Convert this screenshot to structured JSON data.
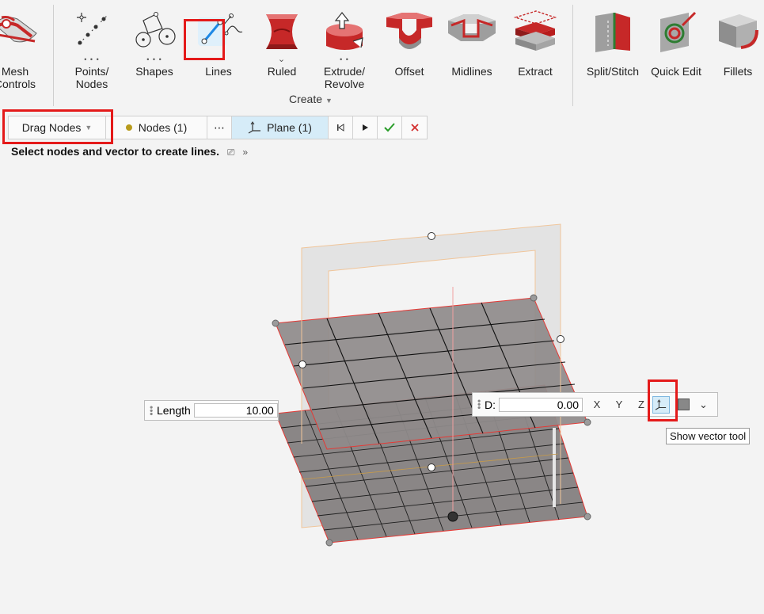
{
  "ribbon": {
    "tools": [
      {
        "id": "mesh-controls",
        "label": "Mesh\nControls"
      },
      {
        "id": "points-nodes",
        "label": "Points/\nNodes"
      },
      {
        "id": "shapes",
        "label": "Shapes"
      },
      {
        "id": "lines",
        "label": "Lines"
      },
      {
        "id": "ruled",
        "label": "Ruled"
      },
      {
        "id": "extrude-revolve",
        "label": "Extrude/\nRevolve"
      },
      {
        "id": "offset",
        "label": "Offset"
      },
      {
        "id": "midlines",
        "label": "Midlines"
      },
      {
        "id": "extract",
        "label": "Extract"
      },
      {
        "id": "split-stitch",
        "label": "Split/Stitch"
      },
      {
        "id": "quick-edit",
        "label": "Quick Edit"
      },
      {
        "id": "fillets",
        "label": "Fillets"
      }
    ],
    "group_label": "Create"
  },
  "context_bar": {
    "mode": "Drag Nodes",
    "nodes": "Nodes (1)",
    "more": "⋯",
    "plane": "Plane (1)"
  },
  "prompt": "Select nodes and vector to create lines.",
  "length_tool": {
    "label": "Length",
    "value": "10.00"
  },
  "plane_tool": {
    "label": "D:",
    "value": "0.00",
    "axes": [
      "X",
      "Y",
      "Z"
    ]
  },
  "tooltip": "Show vector tool",
  "colors": {
    "accent": "#e41a1a",
    "selected": "#d6ecf8",
    "plane": "#8a8686",
    "check": "#2a9d2a"
  }
}
